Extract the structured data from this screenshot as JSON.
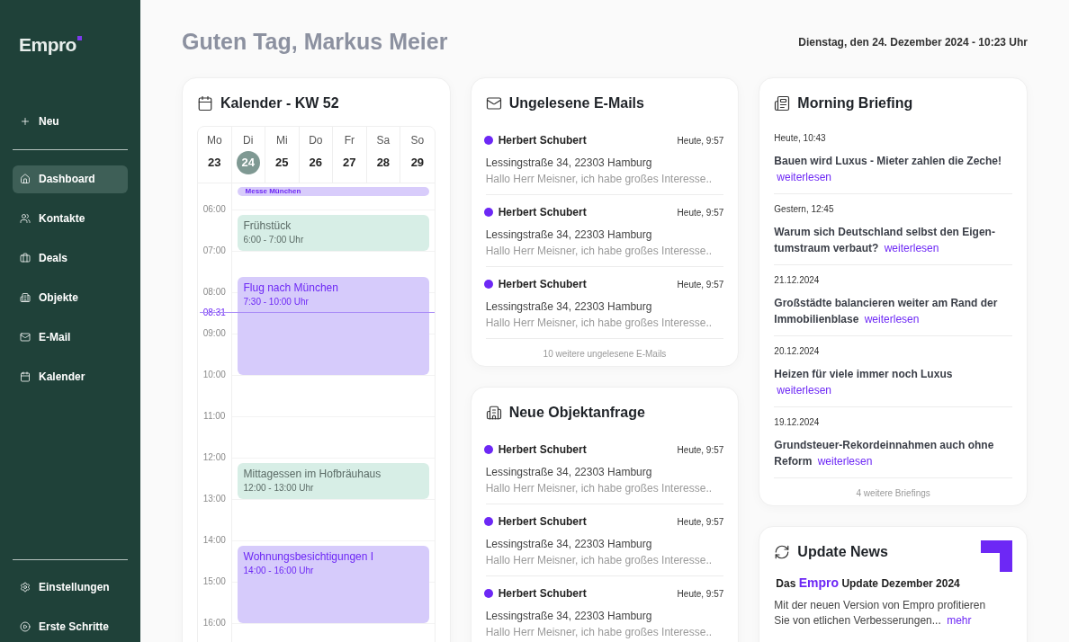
{
  "sidebar": {
    "logo": "Empro",
    "new_button": "Neu",
    "nav": [
      {
        "label": "Dashboard",
        "selected": true
      },
      {
        "label": "Kontakte",
        "selected": false
      },
      {
        "label": "Deals",
        "selected": false
      },
      {
        "label": "Objekte",
        "selected": false
      },
      {
        "label": "E-Mail",
        "selected": false
      },
      {
        "label": "Kalender",
        "selected": false
      }
    ],
    "bottom": [
      {
        "label": "Einstellungen"
      },
      {
        "label": "Erste Schritte"
      }
    ]
  },
  "header": {
    "greeting": "Guten Tag, Markus Meier",
    "date": "Dienstag, den 24. Dezember 2024 - 10:23 Uhr"
  },
  "calendar": {
    "title": "Kalender - KW 52",
    "days": [
      {
        "name": "Mo",
        "date": "23",
        "selected": false
      },
      {
        "name": "Di",
        "date": "24",
        "selected": true
      },
      {
        "name": "Mi",
        "date": "25",
        "selected": false
      },
      {
        "name": "Do",
        "date": "26",
        "selected": false
      },
      {
        "name": "Fr",
        "date": "27",
        "selected": false
      },
      {
        "name": "Sa",
        "date": "28",
        "selected": false
      },
      {
        "name": "So",
        "date": "29",
        "selected": false
      }
    ],
    "all_day": "Messe München",
    "hours": [
      "06:00",
      "07:00",
      "08:00",
      "09:00",
      "10:00",
      "11:00",
      "12:00",
      "13:00",
      "14:00",
      "15:00",
      "16:00"
    ],
    "now": "08:31",
    "events": [
      {
        "title": "Frühstück",
        "time": "6:00 - 7:00 Uhr",
        "kind": "private"
      },
      {
        "title": "Flug nach München",
        "time": "7:30 - 10:00 Uhr",
        "kind": "business"
      },
      {
        "title": "Mittagessen im Hofbräuhaus",
        "time": "12:00 - 13:00 Uhr",
        "kind": "private"
      },
      {
        "title": "Wohnungsbesichtigungen I",
        "time": "14:00 - 16:00 Uhr",
        "kind": "business"
      }
    ]
  },
  "emails": {
    "title": "Ungelesene E-Mails",
    "items": [
      {
        "sender": "Herbert Schubert",
        "time": "Heute, 9:57",
        "subject": "Lessingstraße 34, 22303 Hamburg",
        "preview": "Hallo Herr Meisner, ich habe großes Interesse..",
        "unread": true
      },
      {
        "sender": "Herbert Schubert",
        "time": "Heute, 9:57",
        "subject": "Lessingstraße 34, 22303 Hamburg",
        "preview": "Hallo Herr Meisner, ich habe großes Interesse..",
        "unread": true
      },
      {
        "sender": "Herbert Schubert",
        "time": "Heute, 9:57",
        "subject": "Lessingstraße 34, 22303 Hamburg",
        "preview": "Hallo Herr Meisner, ich habe großes Interesse..",
        "unread": true
      }
    ],
    "more": "10 weitere ungelesene E-Mails"
  },
  "requests": {
    "title": "Neue Objektanfrage",
    "items": [
      {
        "sender": "Herbert Schubert",
        "time": "Heute, 9:57",
        "subject": "Lessingstraße 34, 22303 Hamburg",
        "preview": "Hallo Herr Meisner, ich habe großes Interesse..",
        "unread": true
      },
      {
        "sender": "Herbert Schubert",
        "time": "Heute, 9:57",
        "subject": "Lessingstraße 34, 22303 Hamburg",
        "preview": "Hallo Herr Meisner, ich habe großes Interesse..",
        "unread": true
      },
      {
        "sender": "Herbert Schubert",
        "time": "Heute, 9:57",
        "subject": "Lessingstraße 34, 22303 Hamburg",
        "preview": "Hallo Herr Meisner, ich habe großes Interesse..",
        "unread": true
      }
    ]
  },
  "briefing": {
    "title": "Morning Briefing",
    "items": [
      {
        "date": "Heute, 10:43",
        "headline": "Bauen wird Luxus - Mieter zahlen die Zeche!",
        "link": "weiterlesen"
      },
      {
        "date": "Gestern, 12:45",
        "headline": "Warum sich Deutschland selbst den Eigen-tumstraum verbaut?",
        "link": "weiterlesen"
      },
      {
        "date": "21.12.2024",
        "headline": "Großstädte balancieren weiter am Rand der Immobilienblase",
        "link": "weiterlesen"
      },
      {
        "date": "20.12.2024",
        "headline": "Heizen für viele immer noch Luxus",
        "link": "weiterlesen"
      },
      {
        "date": "19.12.2024",
        "headline": "Grundsteuer-Rekordeinnahmen auch ohne Reform",
        "link": "weiterlesen"
      }
    ],
    "more": "4 weitere Briefings"
  },
  "update": {
    "title": "Update News",
    "headline_before": "Das",
    "headline_brand": "Empro",
    "headline_after": "Update Dezember 2024",
    "text": "Mit der neuen Version von Empro profitieren Sie von etlichen Verbesserungen...",
    "link": "mehr"
  }
}
